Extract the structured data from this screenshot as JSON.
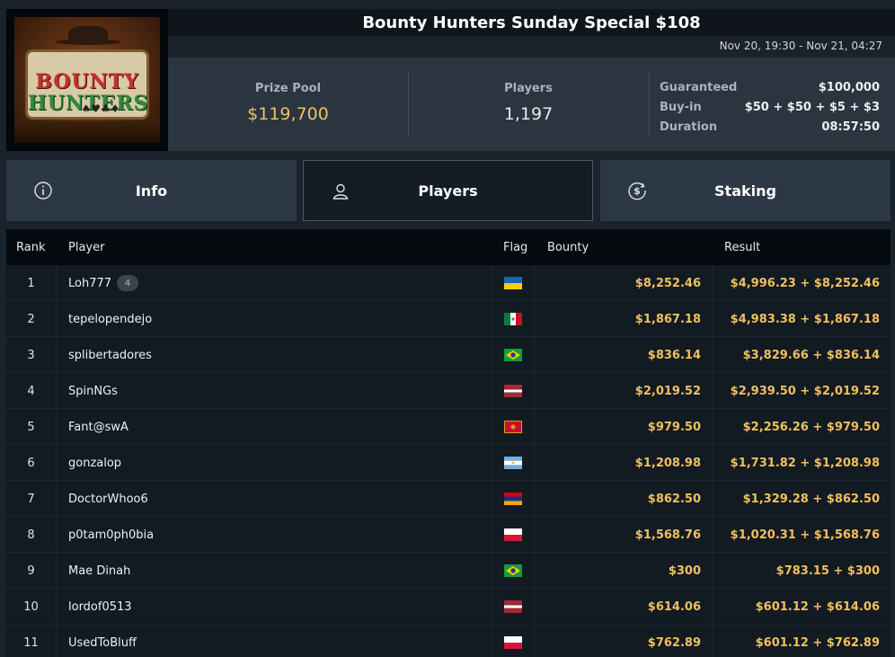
{
  "tournament": {
    "title": "Bounty Hunters Sunday Special $108",
    "dates": "Nov 20, 19:30 - Nov 21, 04:27",
    "logo_words": [
      "BOUNTY",
      "HUNTERS"
    ]
  },
  "stats": {
    "prize_pool_label": "Prize Pool",
    "prize_pool_value": "$119,700",
    "players_label": "Players",
    "players_value": "1,197",
    "guaranteed_label": "Guaranteed",
    "guaranteed_value": "$100,000",
    "buyin_label": "Buy-in",
    "buyin_value": "$50 + $50 + $5 + $3",
    "duration_label": "Duration",
    "duration_value": "08:57:50"
  },
  "tabs": [
    {
      "label": "Info",
      "icon": "info-icon"
    },
    {
      "label": "Players",
      "icon": "user-icon",
      "active": true
    },
    {
      "label": "Staking",
      "icon": "dollar-coin-icon"
    }
  ],
  "table": {
    "headers": {
      "rank": "Rank",
      "player": "Player",
      "flag": "Flag",
      "bounty": "Bounty",
      "result": "Result"
    },
    "rows": [
      {
        "rank": "1",
        "player": "Loh777",
        "badge": "4",
        "flag": "ukraine",
        "bounty": "$8,252.46",
        "result": "$4,996.23 + $8,252.46"
      },
      {
        "rank": "2",
        "player": "tepelopendejo",
        "flag": "mexico",
        "bounty": "$1,867.18",
        "result": "$4,983.38 + $1,867.18"
      },
      {
        "rank": "3",
        "player": "splibertadores",
        "flag": "brazil",
        "bounty": "$836.14",
        "result": "$3,829.66 + $836.14"
      },
      {
        "rank": "4",
        "player": "SpinNGs",
        "flag": "latvia",
        "bounty": "$2,019.52",
        "result": "$2,939.50 + $2,019.52"
      },
      {
        "rank": "5",
        "player": "Fant@swA",
        "flag": "montenegro",
        "bounty": "$979.50",
        "result": "$2,256.26 + $979.50"
      },
      {
        "rank": "6",
        "player": "gonzalop",
        "flag": "argentina",
        "bounty": "$1,208.98",
        "result": "$1,731.82 + $1,208.98"
      },
      {
        "rank": "7",
        "player": "DoctorWhoo6",
        "flag": "armenia",
        "bounty": "$862.50",
        "result": "$1,329.28 + $862.50"
      },
      {
        "rank": "8",
        "player": "p0tam0ph0bia",
        "flag": "poland",
        "bounty": "$1,568.76",
        "result": "$1,020.31 + $1,568.76"
      },
      {
        "rank": "9",
        "player": "Mae Dinah",
        "flag": "brazil",
        "bounty": "$300",
        "result": "$783.15 + $300"
      },
      {
        "rank": "10",
        "player": "lordof0513",
        "flag": "latvia",
        "bounty": "$614.06",
        "result": "$601.12 + $614.06"
      },
      {
        "rank": "11",
        "player": "UsedToBluff",
        "flag": "poland",
        "bounty": "$762.89",
        "result": "$601.12 + $762.89"
      }
    ]
  },
  "colors": {
    "accent_gold": "#f0c060",
    "panel": "#2a3540",
    "header_bg": "#050a0e"
  }
}
